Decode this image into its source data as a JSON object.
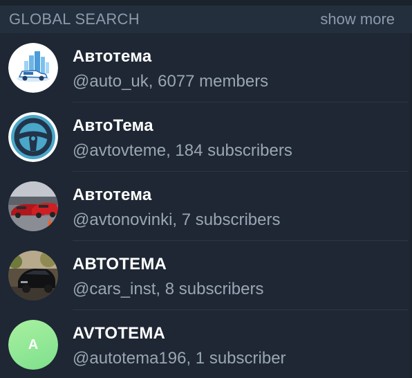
{
  "header": {
    "title": "GLOBAL SEARCH",
    "show_more": "show more"
  },
  "results": [
    {
      "name": "Автотема",
      "subtitle": "@auto_uk, 6077 members",
      "avatar_icon": "city-car-icon"
    },
    {
      "name": "АвтоТема",
      "subtitle": "@avtovteme, 184 subscribers",
      "avatar_icon": "steering-wheel-icon"
    },
    {
      "name": "Автотема",
      "subtitle": "@avtonovinki, 7 subscribers",
      "avatar_icon": "red-sports-cars-photo"
    },
    {
      "name": "АВТОТЕМА",
      "subtitle": "@cars_inst, 8 subscribers",
      "avatar_icon": "black-car-photo"
    },
    {
      "name": "AVTOTEMA",
      "subtitle": "@autotema196, 1 subscriber",
      "avatar_letter": "A",
      "avatar_color": "#8fe895"
    }
  ]
}
